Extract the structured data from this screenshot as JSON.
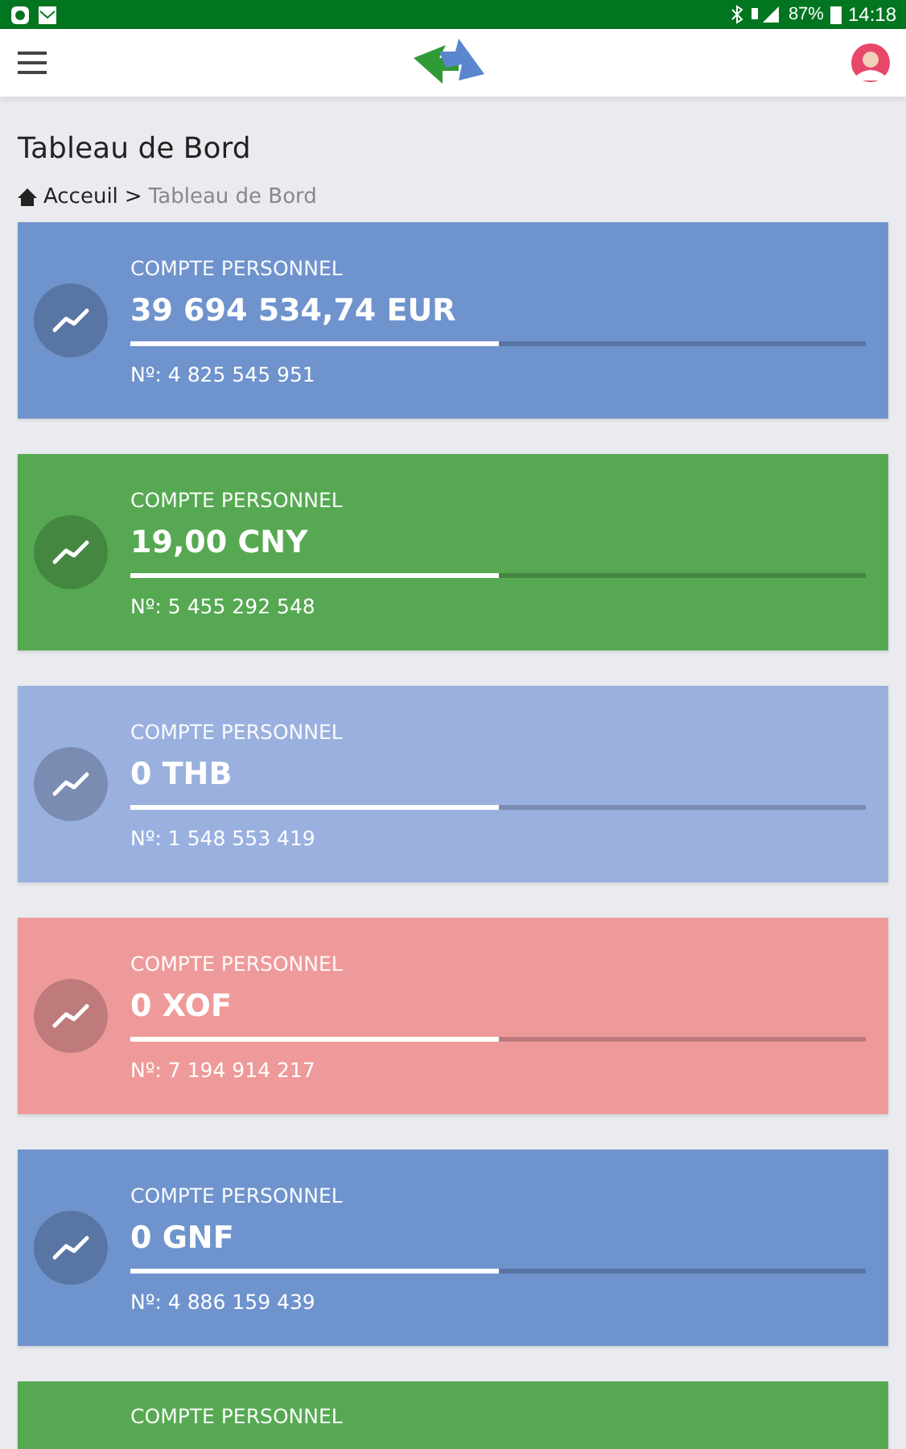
{
  "status_bar": {
    "battery": "87%",
    "time": "14:18"
  },
  "page": {
    "title": "Tableau de Bord",
    "breadcrumb": {
      "home": "Acceuil",
      "separator": ">",
      "current": "Tableau de Bord"
    }
  },
  "accounts": [
    {
      "label": "COMPTE PERSONNEL",
      "balance": "39 694 534,74 EUR",
      "number": "Nº: 4 825 545 951",
      "level": 0.5,
      "color": "#6f93cd"
    },
    {
      "label": "COMPTE PERSONNEL",
      "balance": "19,00 CNY",
      "number": "Nº: 5 455 292 548",
      "level": 0.5,
      "color": "#56a952"
    },
    {
      "label": "COMPTE PERSONNEL",
      "balance": "0 THB",
      "number": "Nº: 1 548 553 419",
      "level": 0.5,
      "color": "#9ab0df"
    },
    {
      "label": "COMPTE PERSONNEL",
      "balance": "0 XOF",
      "number": "Nº: 7 194 914 217",
      "level": 0.5,
      "color": "#ef9a9a"
    },
    {
      "label": "COMPTE PERSONNEL",
      "balance": "0 GNF",
      "number": "Nº: 4 886 159 439",
      "level": 0.5,
      "color": "#6f93cd"
    },
    {
      "label": "COMPTE PERSONNEL",
      "color": "#56a952"
    }
  ]
}
